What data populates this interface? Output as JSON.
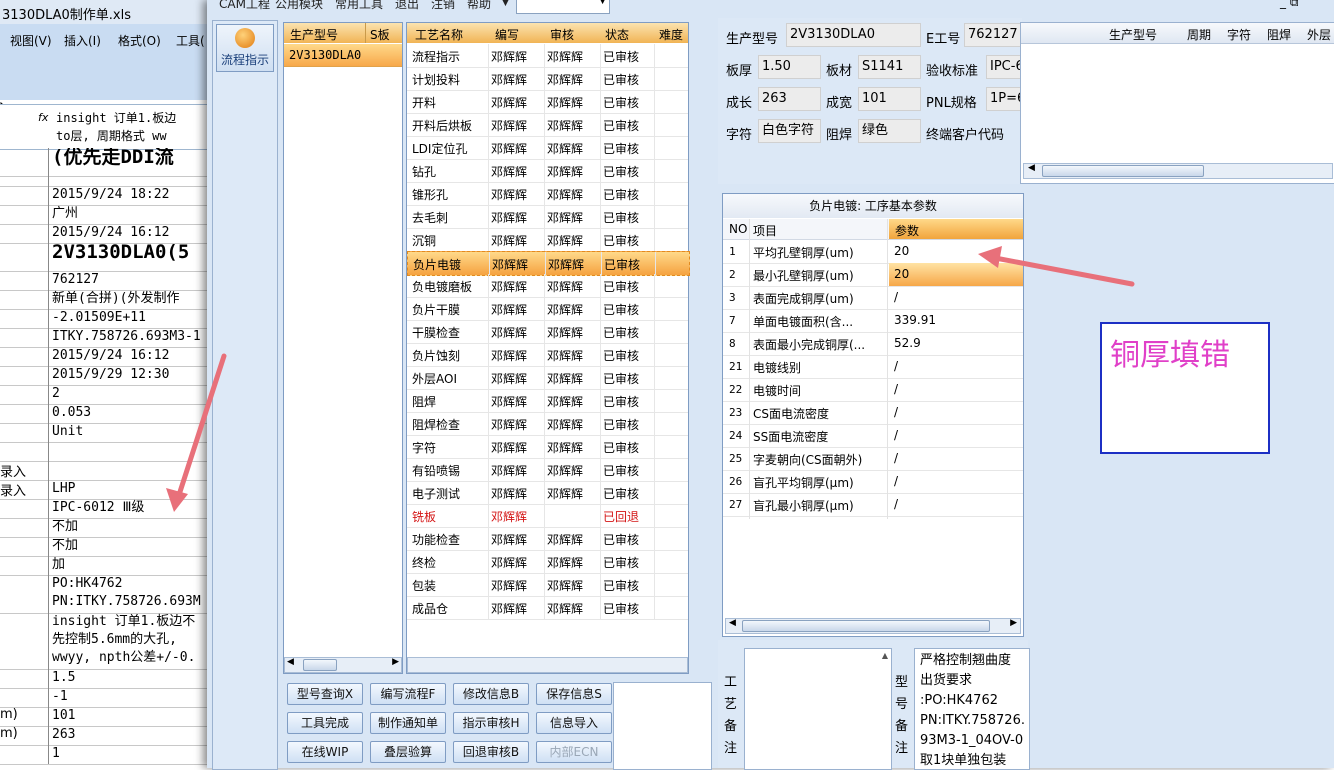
{
  "excel": {
    "title": "3130DLA0制作单.xls",
    "menu": [
      "视图(V)",
      "插入(I)",
      "格式(O)",
      "工具("
    ],
    "fx": "fx",
    "formula_text": "insight 订单1.板边\nto层, 周期格式 ww",
    "rows": [
      {
        "a": "",
        "b": "(优先走DDI流",
        "style": "big"
      },
      {
        "a": "",
        "b": ""
      },
      {
        "a": "",
        "b": "2015/9/24 18:22"
      },
      {
        "a": "",
        "b": "广州"
      },
      {
        "a": "",
        "b": "2015/9/24 16:12"
      },
      {
        "a": "",
        "b": "2V3130DLA0(5",
        "style": "big"
      },
      {
        "a": "",
        "b": "762127"
      },
      {
        "a": "",
        "b": "新单(合拼)(外发制作"
      },
      {
        "a": "",
        "b": "-2.01509E+11"
      },
      {
        "a": "",
        "b": "ITKY.758726.693M3-1"
      },
      {
        "a": "",
        "b": "2015/9/24 16:12"
      },
      {
        "a": "",
        "b": "2015/9/29 12:30"
      },
      {
        "a": "",
        "b": "2"
      },
      {
        "a": "",
        "b": "0.053"
      },
      {
        "a": "",
        "b": "Unit"
      },
      {
        "a": "",
        "b": ""
      },
      {
        "a": "录入",
        "b": ""
      },
      {
        "a": "录入",
        "b": "LHP"
      },
      {
        "a": "",
        "b": "IPC-6012 Ⅲ级"
      },
      {
        "a": "",
        "b": "不加"
      },
      {
        "a": "",
        "b": "不加"
      },
      {
        "a": "",
        "b": "加"
      },
      {
        "a": "",
        "b": "PO:HK4762\nPN:ITKY.758726.693M",
        "style": "wrap"
      },
      {
        "a": "",
        "b": "insight 订单1.板边不\n先控制5.6mm的大孔,\nwwyy, npth公差+/-0.",
        "style": "wrap"
      },
      {
        "a": "",
        "b": "1.5"
      },
      {
        "a": "",
        "b": "-1"
      },
      {
        "a": "m)",
        "b": "101"
      },
      {
        "a": "m)",
        "b": "263"
      },
      {
        "a": "",
        "b": "1"
      }
    ]
  },
  "menubar": {
    "items": [
      "CAM工程",
      "公用模块",
      "常用工具",
      "退出",
      "注销",
      "帮助"
    ],
    "win_controls": "_ ⧉"
  },
  "nav": {
    "flow_label": "流程指示"
  },
  "model_list": {
    "headers": [
      "生产型号",
      "S板"
    ],
    "rows": [
      "2V3130DLA0"
    ]
  },
  "process": {
    "headers": [
      "工艺名称",
      "编写",
      "审核",
      "状态",
      "难度"
    ],
    "rows": [
      {
        "name": "流程指示",
        "author": "邓辉辉",
        "reviewer": "邓辉辉",
        "status": "已审核"
      },
      {
        "name": "计划投料",
        "author": "邓辉辉",
        "reviewer": "邓辉辉",
        "status": "已审核"
      },
      {
        "name": "开料",
        "author": "邓辉辉",
        "reviewer": "邓辉辉",
        "status": "已审核"
      },
      {
        "name": "开料后烘板",
        "author": "邓辉辉",
        "reviewer": "邓辉辉",
        "status": "已审核"
      },
      {
        "name": "LDI定位孔",
        "author": "邓辉辉",
        "reviewer": "邓辉辉",
        "status": "已审核"
      },
      {
        "name": "钻孔",
        "author": "邓辉辉",
        "reviewer": "邓辉辉",
        "status": "已审核"
      },
      {
        "name": "锥形孔",
        "author": "邓辉辉",
        "reviewer": "邓辉辉",
        "status": "已审核"
      },
      {
        "name": "去毛刺",
        "author": "邓辉辉",
        "reviewer": "邓辉辉",
        "status": "已审核"
      },
      {
        "name": "沉铜",
        "author": "邓辉辉",
        "reviewer": "邓辉辉",
        "status": "已审核"
      },
      {
        "name": "负片电镀",
        "author": "邓辉辉",
        "reviewer": "邓辉辉",
        "status": "已审核",
        "selected": true
      },
      {
        "name": "负电镀磨板",
        "author": "邓辉辉",
        "reviewer": "邓辉辉",
        "status": "已审核"
      },
      {
        "name": "负片干膜",
        "author": "邓辉辉",
        "reviewer": "邓辉辉",
        "status": "已审核"
      },
      {
        "name": "干膜检查",
        "author": "邓辉辉",
        "reviewer": "邓辉辉",
        "status": "已审核"
      },
      {
        "name": "负片蚀刻",
        "author": "邓辉辉",
        "reviewer": "邓辉辉",
        "status": "已审核"
      },
      {
        "name": "外层AOI",
        "author": "邓辉辉",
        "reviewer": "邓辉辉",
        "status": "已审核"
      },
      {
        "name": "阻焊",
        "author": "邓辉辉",
        "reviewer": "邓辉辉",
        "status": "已审核"
      },
      {
        "name": "阻焊检查",
        "author": "邓辉辉",
        "reviewer": "邓辉辉",
        "status": "已审核"
      },
      {
        "name": "字符",
        "author": "邓辉辉",
        "reviewer": "邓辉辉",
        "status": "已审核"
      },
      {
        "name": "有铅喷锡",
        "author": "邓辉辉",
        "reviewer": "邓辉辉",
        "status": "已审核"
      },
      {
        "name": "电子测试",
        "author": "邓辉辉",
        "reviewer": "邓辉辉",
        "status": "已审核"
      },
      {
        "name": "铣板",
        "author": "邓辉辉",
        "reviewer": "",
        "status": "已回退",
        "rejected": true
      },
      {
        "name": "功能检查",
        "author": "邓辉辉",
        "reviewer": "邓辉辉",
        "status": "已审核"
      },
      {
        "name": "终检",
        "author": "邓辉辉",
        "reviewer": "邓辉辉",
        "status": "已审核"
      },
      {
        "name": "包装",
        "author": "邓辉辉",
        "reviewer": "邓辉辉",
        "status": "已审核"
      },
      {
        "name": "成品仓",
        "author": "邓辉辉",
        "reviewer": "邓辉辉",
        "status": "已审核"
      }
    ]
  },
  "buttons": [
    {
      "label": "型号查询X",
      "disabled": false
    },
    {
      "label": "编写流程F",
      "disabled": false
    },
    {
      "label": "修改信息B",
      "disabled": false
    },
    {
      "label": "保存信息S",
      "disabled": false
    },
    {
      "label": "工具完成",
      "disabled": false
    },
    {
      "label": "制作通知单",
      "disabled": false
    },
    {
      "label": "指示审核H",
      "disabled": false
    },
    {
      "label": "信息导入",
      "disabled": false
    },
    {
      "label": "在线WIP",
      "disabled": false
    },
    {
      "label": "叠层验算",
      "disabled": false
    },
    {
      "label": "回退审核B",
      "disabled": false
    },
    {
      "label": "内部ECN",
      "disabled": true
    }
  ],
  "info": {
    "production_model_label": "生产型号",
    "production_model": "2V3130DLA0",
    "e_no_label": "E工号",
    "e_no": "762127",
    "thickness_label": "板厚",
    "thickness": "1.50",
    "material_label": "板材",
    "material": "S1141",
    "standard_label": "验收标准",
    "standard": "IPC-6",
    "length_label": "成长",
    "length": "263",
    "width_label": "成宽",
    "width": "101",
    "pnl_label": "PNL规格",
    "pnl": "1P=6",
    "char_label": "字符",
    "char": "白色字符",
    "mask_label": "阻焊",
    "mask": "绿色",
    "customer_label": "终端客户代码",
    "grid_headers": [
      "生产型号",
      "周期",
      "字符",
      "阻焊",
      "外层"
    ]
  },
  "params": {
    "title": "负片电镀: 工序基本参数",
    "headers": {
      "no": "NO",
      "item": "项目",
      "value": "参数"
    },
    "rows": [
      {
        "no": "1",
        "item": "平均孔壁铜厚(um)",
        "value": "20"
      },
      {
        "no": "2",
        "item": "最小孔壁铜厚(um)",
        "value": "20",
        "selected": true
      },
      {
        "no": "3",
        "item": "表面完成铜厚(um)",
        "value": "/"
      },
      {
        "no": "7",
        "item": "单面电镀面积(含...",
        "value": "339.91"
      },
      {
        "no": "8",
        "item": "表面最小完成铜厚(...",
        "value": "52.9"
      },
      {
        "no": "21",
        "item": "电镀线别",
        "value": "/"
      },
      {
        "no": "22",
        "item": "电镀时间",
        "value": "/"
      },
      {
        "no": "23",
        "item": "CS面电流密度",
        "value": "/"
      },
      {
        "no": "24",
        "item": "SS面电流密度",
        "value": "/"
      },
      {
        "no": "25",
        "item": "字麦朝向(CS面朝外)",
        "value": "/"
      },
      {
        "no": "26",
        "item": "盲孔平均铜厚(μm)",
        "value": "/"
      },
      {
        "no": "27",
        "item": "盲孔最小铜厚(μm)",
        "value": "/"
      }
    ]
  },
  "remarks": {
    "process_label": "工艺备注",
    "model_label": "型号备注",
    "model_text": "严格控制翘曲度\n出货要求\n:PO:HK4762\nPN:ITKY.758726.93M3-1_04OV-0\n取1块单独包装"
  },
  "annotation": {
    "text": "铜厚填错",
    "text_color": "#e040c8",
    "box_color": "#1c2fc4",
    "arrow_color": "#e8707a"
  }
}
